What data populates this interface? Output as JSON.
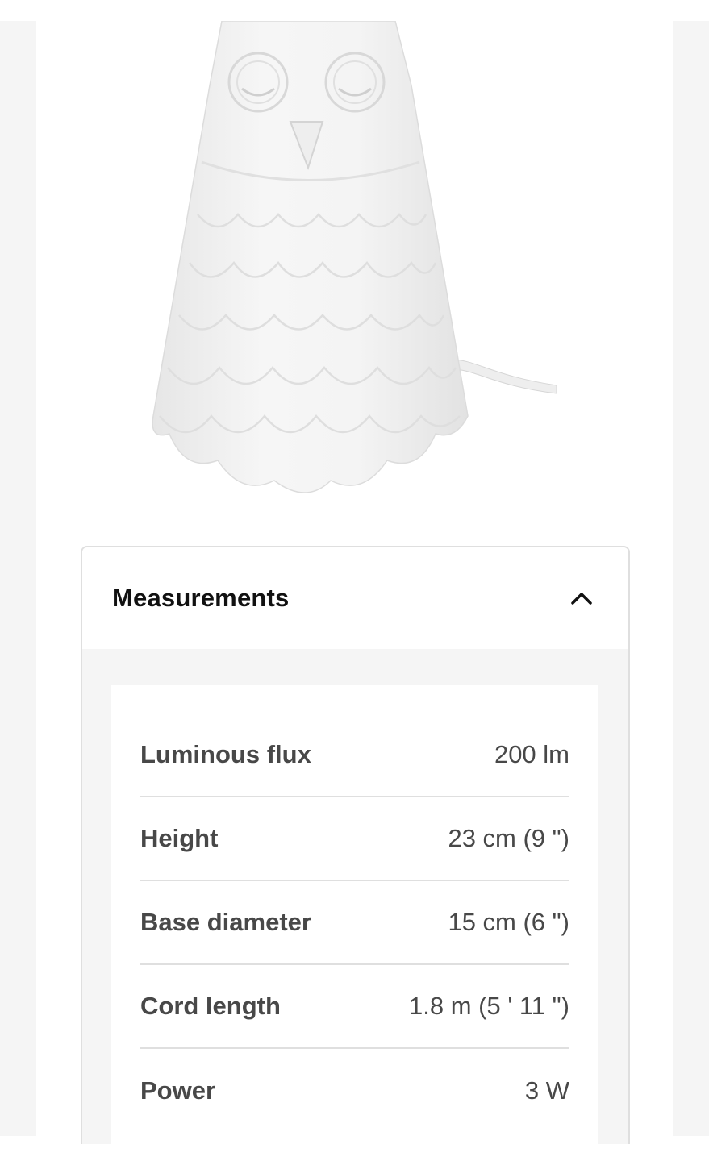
{
  "product_image": {
    "alt_icon": "owl-lamp-image"
  },
  "accordion": {
    "title": "Measurements",
    "expanded": true,
    "toggle_icon": "chevron-up-icon"
  },
  "measurements": [
    {
      "label": "Luminous flux",
      "value": "200 lm"
    },
    {
      "label": "Height",
      "value": "23 cm (9 \")"
    },
    {
      "label": "Base diameter",
      "value": "15 cm (6 \")"
    },
    {
      "label": "Cord length",
      "value": "1.8 m (5 ' 11 \")"
    },
    {
      "label": "Power",
      "value": "3 W"
    }
  ],
  "colors": {
    "gutter": "#f5f5f5",
    "border": "#dfdfdf",
    "text_dark": "#111111",
    "text_body": "#484848"
  }
}
